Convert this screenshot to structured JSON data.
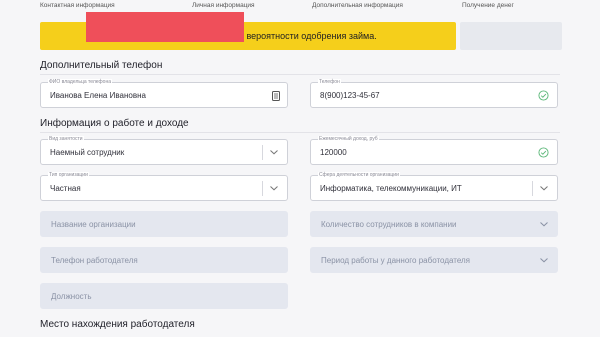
{
  "steps": [
    "Контактная информация",
    "Личная информация",
    "Дополнительная информация",
    "Получение денег"
  ],
  "banner": {
    "text": "к вероятности одобрения займа."
  },
  "sections": {
    "extra_phone": "Дополнительный телефон",
    "work": "Информация о работе и доходе",
    "employer_location": "Место нахождения работодателя"
  },
  "fields": {
    "owner_name": {
      "label": "ФИО владельца телефона",
      "value": "Иванова Елена Ивановна"
    },
    "phone": {
      "label": "Телефон",
      "value": "8(900)123-45-67"
    },
    "employment": {
      "label": "Вид занятости",
      "value": "Наемный сотрудник"
    },
    "income": {
      "label": "Ежемесячный доход, руб",
      "value": "120000"
    },
    "org_type": {
      "label": "Тип организации",
      "value": "Частная"
    },
    "org_sphere": {
      "label": "Сфера деятельности организации",
      "value": "Информатика, телекоммуникации, ИТ"
    },
    "org_name": {
      "placeholder": "Название организации"
    },
    "employees": {
      "placeholder": "Количество сотрудников в компании"
    },
    "employer_phone": {
      "placeholder": "Телефон работодателя"
    },
    "work_period": {
      "placeholder": "Период работы у данного работодателя"
    },
    "position": {
      "placeholder": "Должность"
    }
  },
  "colors": {
    "banner": "#f5cf1b",
    "accent_red": "#ef4f5a",
    "check_green": "#5db87a"
  }
}
